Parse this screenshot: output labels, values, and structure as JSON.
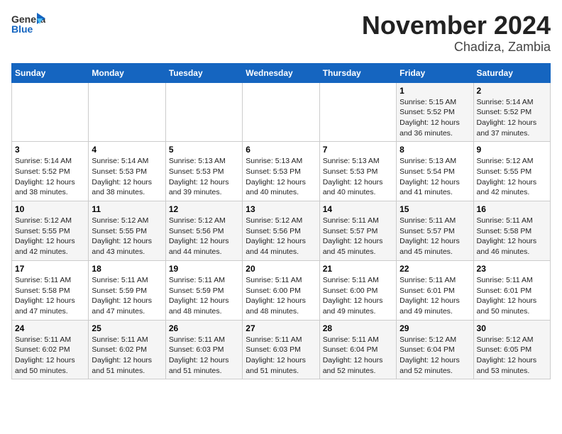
{
  "header": {
    "logo_line1": "General",
    "logo_line2": "Blue",
    "title": "November 2024",
    "subtitle": "Chadiza, Zambia"
  },
  "days_of_week": [
    "Sunday",
    "Monday",
    "Tuesday",
    "Wednesday",
    "Thursday",
    "Friday",
    "Saturday"
  ],
  "weeks": [
    [
      {
        "day": "",
        "info": ""
      },
      {
        "day": "",
        "info": ""
      },
      {
        "day": "",
        "info": ""
      },
      {
        "day": "",
        "info": ""
      },
      {
        "day": "",
        "info": ""
      },
      {
        "day": "1",
        "info": "Sunrise: 5:15 AM\nSunset: 5:52 PM\nDaylight: 12 hours\nand 36 minutes."
      },
      {
        "day": "2",
        "info": "Sunrise: 5:14 AM\nSunset: 5:52 PM\nDaylight: 12 hours\nand 37 minutes."
      }
    ],
    [
      {
        "day": "3",
        "info": "Sunrise: 5:14 AM\nSunset: 5:52 PM\nDaylight: 12 hours\nand 38 minutes."
      },
      {
        "day": "4",
        "info": "Sunrise: 5:14 AM\nSunset: 5:53 PM\nDaylight: 12 hours\nand 38 minutes."
      },
      {
        "day": "5",
        "info": "Sunrise: 5:13 AM\nSunset: 5:53 PM\nDaylight: 12 hours\nand 39 minutes."
      },
      {
        "day": "6",
        "info": "Sunrise: 5:13 AM\nSunset: 5:53 PM\nDaylight: 12 hours\nand 40 minutes."
      },
      {
        "day": "7",
        "info": "Sunrise: 5:13 AM\nSunset: 5:53 PM\nDaylight: 12 hours\nand 40 minutes."
      },
      {
        "day": "8",
        "info": "Sunrise: 5:13 AM\nSunset: 5:54 PM\nDaylight: 12 hours\nand 41 minutes."
      },
      {
        "day": "9",
        "info": "Sunrise: 5:12 AM\nSunset: 5:55 PM\nDaylight: 12 hours\nand 42 minutes."
      }
    ],
    [
      {
        "day": "10",
        "info": "Sunrise: 5:12 AM\nSunset: 5:55 PM\nDaylight: 12 hours\nand 42 minutes."
      },
      {
        "day": "11",
        "info": "Sunrise: 5:12 AM\nSunset: 5:55 PM\nDaylight: 12 hours\nand 43 minutes."
      },
      {
        "day": "12",
        "info": "Sunrise: 5:12 AM\nSunset: 5:56 PM\nDaylight: 12 hours\nand 44 minutes."
      },
      {
        "day": "13",
        "info": "Sunrise: 5:12 AM\nSunset: 5:56 PM\nDaylight: 12 hours\nand 44 minutes."
      },
      {
        "day": "14",
        "info": "Sunrise: 5:11 AM\nSunset: 5:57 PM\nDaylight: 12 hours\nand 45 minutes."
      },
      {
        "day": "15",
        "info": "Sunrise: 5:11 AM\nSunset: 5:57 PM\nDaylight: 12 hours\nand 45 minutes."
      },
      {
        "day": "16",
        "info": "Sunrise: 5:11 AM\nSunset: 5:58 PM\nDaylight: 12 hours\nand 46 minutes."
      }
    ],
    [
      {
        "day": "17",
        "info": "Sunrise: 5:11 AM\nSunset: 5:58 PM\nDaylight: 12 hours\nand 47 minutes."
      },
      {
        "day": "18",
        "info": "Sunrise: 5:11 AM\nSunset: 5:59 PM\nDaylight: 12 hours\nand 47 minutes."
      },
      {
        "day": "19",
        "info": "Sunrise: 5:11 AM\nSunset: 5:59 PM\nDaylight: 12 hours\nand 48 minutes."
      },
      {
        "day": "20",
        "info": "Sunrise: 5:11 AM\nSunset: 6:00 PM\nDaylight: 12 hours\nand 48 minutes."
      },
      {
        "day": "21",
        "info": "Sunrise: 5:11 AM\nSunset: 6:00 PM\nDaylight: 12 hours\nand 49 minutes."
      },
      {
        "day": "22",
        "info": "Sunrise: 5:11 AM\nSunset: 6:01 PM\nDaylight: 12 hours\nand 49 minutes."
      },
      {
        "day": "23",
        "info": "Sunrise: 5:11 AM\nSunset: 6:01 PM\nDaylight: 12 hours\nand 50 minutes."
      }
    ],
    [
      {
        "day": "24",
        "info": "Sunrise: 5:11 AM\nSunset: 6:02 PM\nDaylight: 12 hours\nand 50 minutes."
      },
      {
        "day": "25",
        "info": "Sunrise: 5:11 AM\nSunset: 6:02 PM\nDaylight: 12 hours\nand 51 minutes."
      },
      {
        "day": "26",
        "info": "Sunrise: 5:11 AM\nSunset: 6:03 PM\nDaylight: 12 hours\nand 51 minutes."
      },
      {
        "day": "27",
        "info": "Sunrise: 5:11 AM\nSunset: 6:03 PM\nDaylight: 12 hours\nand 51 minutes."
      },
      {
        "day": "28",
        "info": "Sunrise: 5:11 AM\nSunset: 6:04 PM\nDaylight: 12 hours\nand 52 minutes."
      },
      {
        "day": "29",
        "info": "Sunrise: 5:12 AM\nSunset: 6:04 PM\nDaylight: 12 hours\nand 52 minutes."
      },
      {
        "day": "30",
        "info": "Sunrise: 5:12 AM\nSunset: 6:05 PM\nDaylight: 12 hours\nand 53 minutes."
      }
    ]
  ]
}
